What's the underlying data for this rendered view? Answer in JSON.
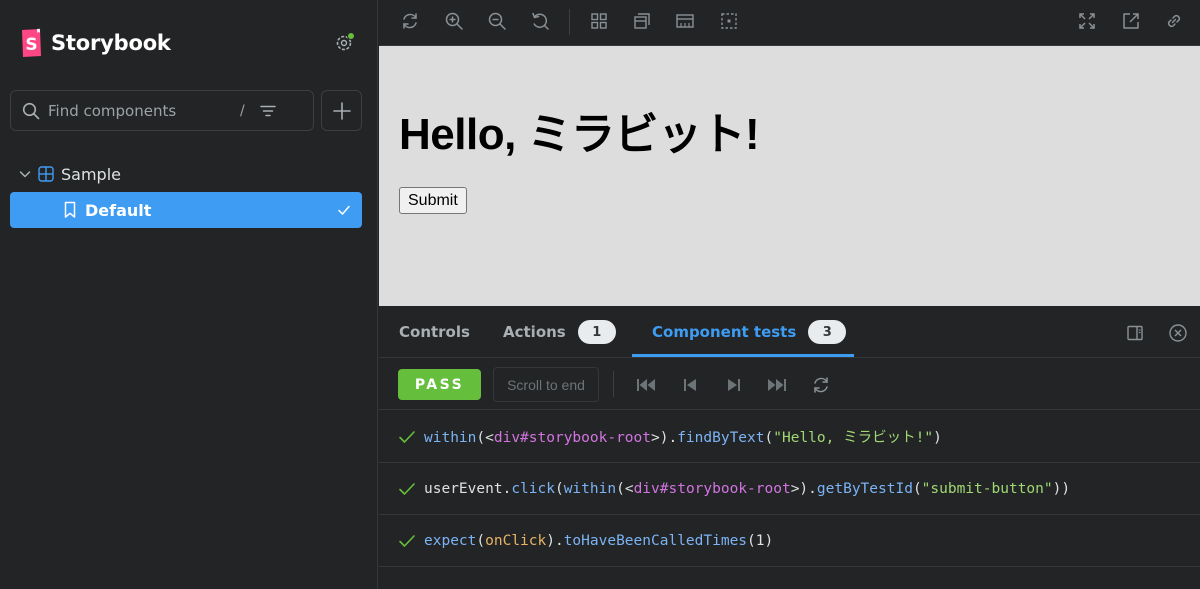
{
  "sidebar": {
    "brand": "Storybook",
    "search": {
      "placeholder": "Find components",
      "shortcut": "/"
    },
    "tree": {
      "group_label": "Sample",
      "story_label": "Default"
    }
  },
  "preview": {
    "heading": "Hello, ミラビット!",
    "button_label": "Submit"
  },
  "panel": {
    "tabs": [
      {
        "label": "Controls"
      },
      {
        "label": "Actions",
        "badge": "1"
      },
      {
        "label": "Component tests",
        "badge": "3"
      }
    ],
    "status": "PASS",
    "scroll_to_end": "Scroll to end",
    "log": [
      {
        "parts": [
          [
            "fn",
            "within"
          ],
          [
            "p",
            "(<"
          ],
          [
            "tag",
            "div#storybook-root"
          ],
          [
            "p",
            ">)."
          ],
          [
            "fn",
            "findByText"
          ],
          [
            "p",
            "("
          ],
          [
            "str",
            "\"Hello, ミラビット!\""
          ],
          [
            "p",
            ")"
          ]
        ]
      },
      {
        "parts": [
          [
            "p",
            "userEvent."
          ],
          [
            "fn",
            "click"
          ],
          [
            "p",
            "("
          ],
          [
            "fn",
            "within"
          ],
          [
            "p",
            "(<"
          ],
          [
            "tag",
            "div#storybook-root"
          ],
          [
            "p",
            ">)."
          ],
          [
            "fn",
            "getByTestId"
          ],
          [
            "p",
            "("
          ],
          [
            "str",
            "\"submit-button\""
          ],
          [
            "p",
            "))"
          ]
        ]
      },
      {
        "parts": [
          [
            "fn",
            "expect"
          ],
          [
            "p",
            "("
          ],
          [
            "var",
            "onClick"
          ],
          [
            "p",
            ")."
          ],
          [
            "fn",
            "toHaveBeenCalledTimes"
          ],
          [
            "p",
            "("
          ],
          [
            "num",
            "1"
          ],
          [
            "p",
            ")"
          ]
        ]
      }
    ]
  },
  "colors": {
    "accent": "#3f9cf3",
    "pass": "#66bf3c",
    "sidebar_bg": "#222425",
    "preview_bg": "#dddddd"
  },
  "icons": {
    "toolbar": [
      "reload-icon",
      "zoom-in-icon",
      "zoom-out-icon",
      "reset-zoom-icon",
      "grid-icon",
      "background-icon",
      "viewport-icon",
      "outline-icon",
      "fullscreen-icon",
      "open-new-tab-icon",
      "copy-link-icon"
    ],
    "controls": [
      "jump-start-icon",
      "step-back-icon",
      "step-forward-icon",
      "jump-end-icon",
      "rerun-icon"
    ]
  }
}
